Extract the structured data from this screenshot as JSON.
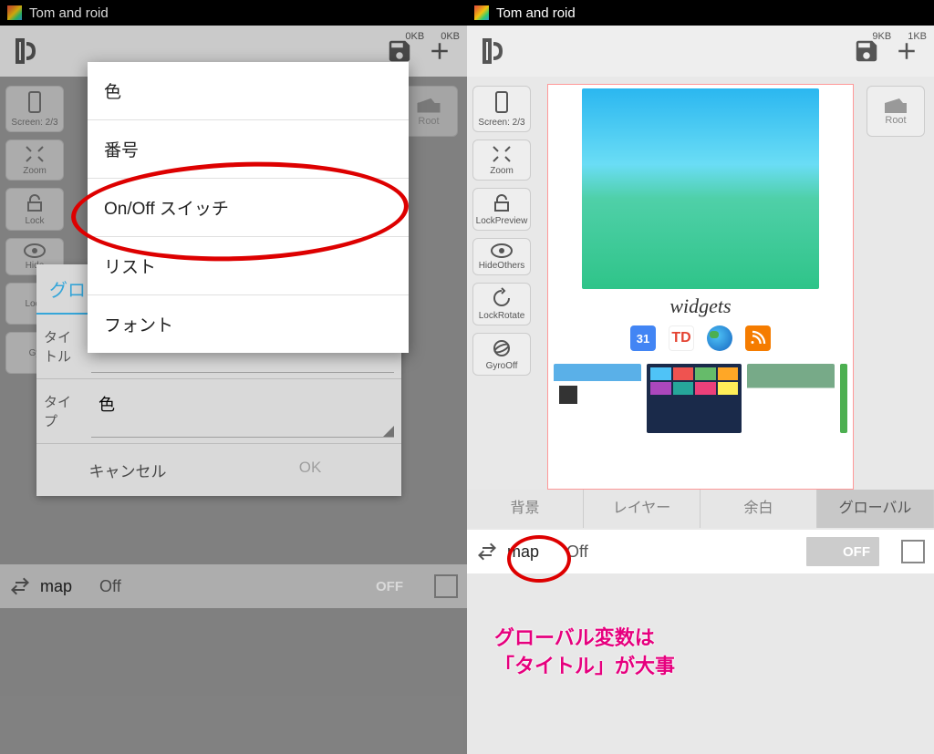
{
  "status": {
    "title": "Tom and roid"
  },
  "toolbar": {
    "kb_left_l": "0KB",
    "kb_right_l": "0KB",
    "kb_left_r": "9KB",
    "kb_right_r": "1KB"
  },
  "side": {
    "screen": "Screen: 2/3",
    "zoom": "Zoom",
    "lockPreview_l": "Lock",
    "lockPreview_r": "LockPreview",
    "hideOthers_l": "Hide",
    "hideOthers_r": "HideOthers",
    "lockRotate_l": "Lock",
    "lockRotate_r": "LockRotate",
    "gyro_l": "Gy",
    "gyro_r": "GyroOff",
    "root": "Root"
  },
  "popup": {
    "items": [
      "色",
      "番号",
      "On/Off スイッチ",
      "リスト",
      "フォント"
    ]
  },
  "dialog": {
    "tab": "グロ",
    "title_label": "タイトル",
    "type_label": "タイプ",
    "type_value": "色",
    "cancel": "キャンセル",
    "ok": "OK"
  },
  "globals": {
    "name": "map",
    "value": "Off",
    "toggle": "OFF"
  },
  "preview": {
    "widgets_label": "widgets"
  },
  "tabs": {
    "bg": "背景",
    "layer": "レイヤー",
    "margin": "余白",
    "global": "グローバル"
  },
  "annotation": {
    "line1": "グローバル変数は",
    "line2": "「タイトル」が大事"
  },
  "icons": {
    "calendar_color": "#4285f4",
    "todoist_color": "#e44332",
    "earth_color": "#fff",
    "rss_color": "#f57c00"
  }
}
